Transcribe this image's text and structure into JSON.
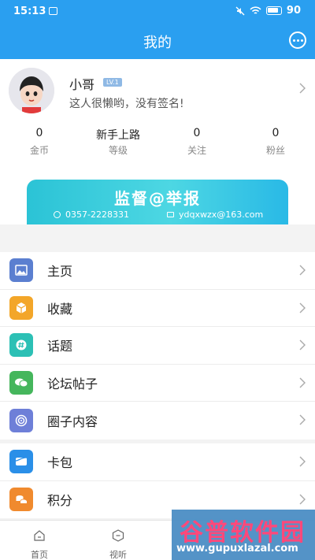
{
  "status_bar": {
    "time": "15:13",
    "battery": "90"
  },
  "header": {
    "title": "我的"
  },
  "profile": {
    "username": "小哥",
    "level": "LV.1",
    "bio": "这人很懒哟，没有签名!"
  },
  "stats": [
    {
      "value": "0",
      "label": "金币"
    },
    {
      "value": "新手上路",
      "label": "等级"
    },
    {
      "value": "0",
      "label": "关注"
    },
    {
      "value": "0",
      "label": "粉丝"
    }
  ],
  "banner": {
    "title": "监督@举报",
    "phone": "0357-2228331",
    "email": "ydqxwzx@163.com"
  },
  "menu_group_1": [
    {
      "label": "主页",
      "icon": "image-icon",
      "color": "#5b7fd0"
    },
    {
      "label": "收藏",
      "icon": "box-icon",
      "color": "#f3a629"
    },
    {
      "label": "话题",
      "icon": "hashtag-icon",
      "color": "#2cc0b5"
    },
    {
      "label": "论坛帖子",
      "icon": "chat-bubbles-icon",
      "color": "#45b65c"
    },
    {
      "label": "圈子内容",
      "icon": "spiral-icon",
      "color": "#6e7fd8"
    }
  ],
  "menu_group_2": [
    {
      "label": "卡包",
      "icon": "wallet-icon",
      "color": "#2a8fe8"
    },
    {
      "label": "积分",
      "icon": "coins-icon",
      "color": "#f08a2e"
    }
  ],
  "tabbar": [
    {
      "label": "首页",
      "icon": "home-icon"
    },
    {
      "label": "视听",
      "icon": "play-icon"
    }
  ],
  "watermark": {
    "title": "谷普软件园",
    "url": "www.gupuxlazal.com"
  }
}
